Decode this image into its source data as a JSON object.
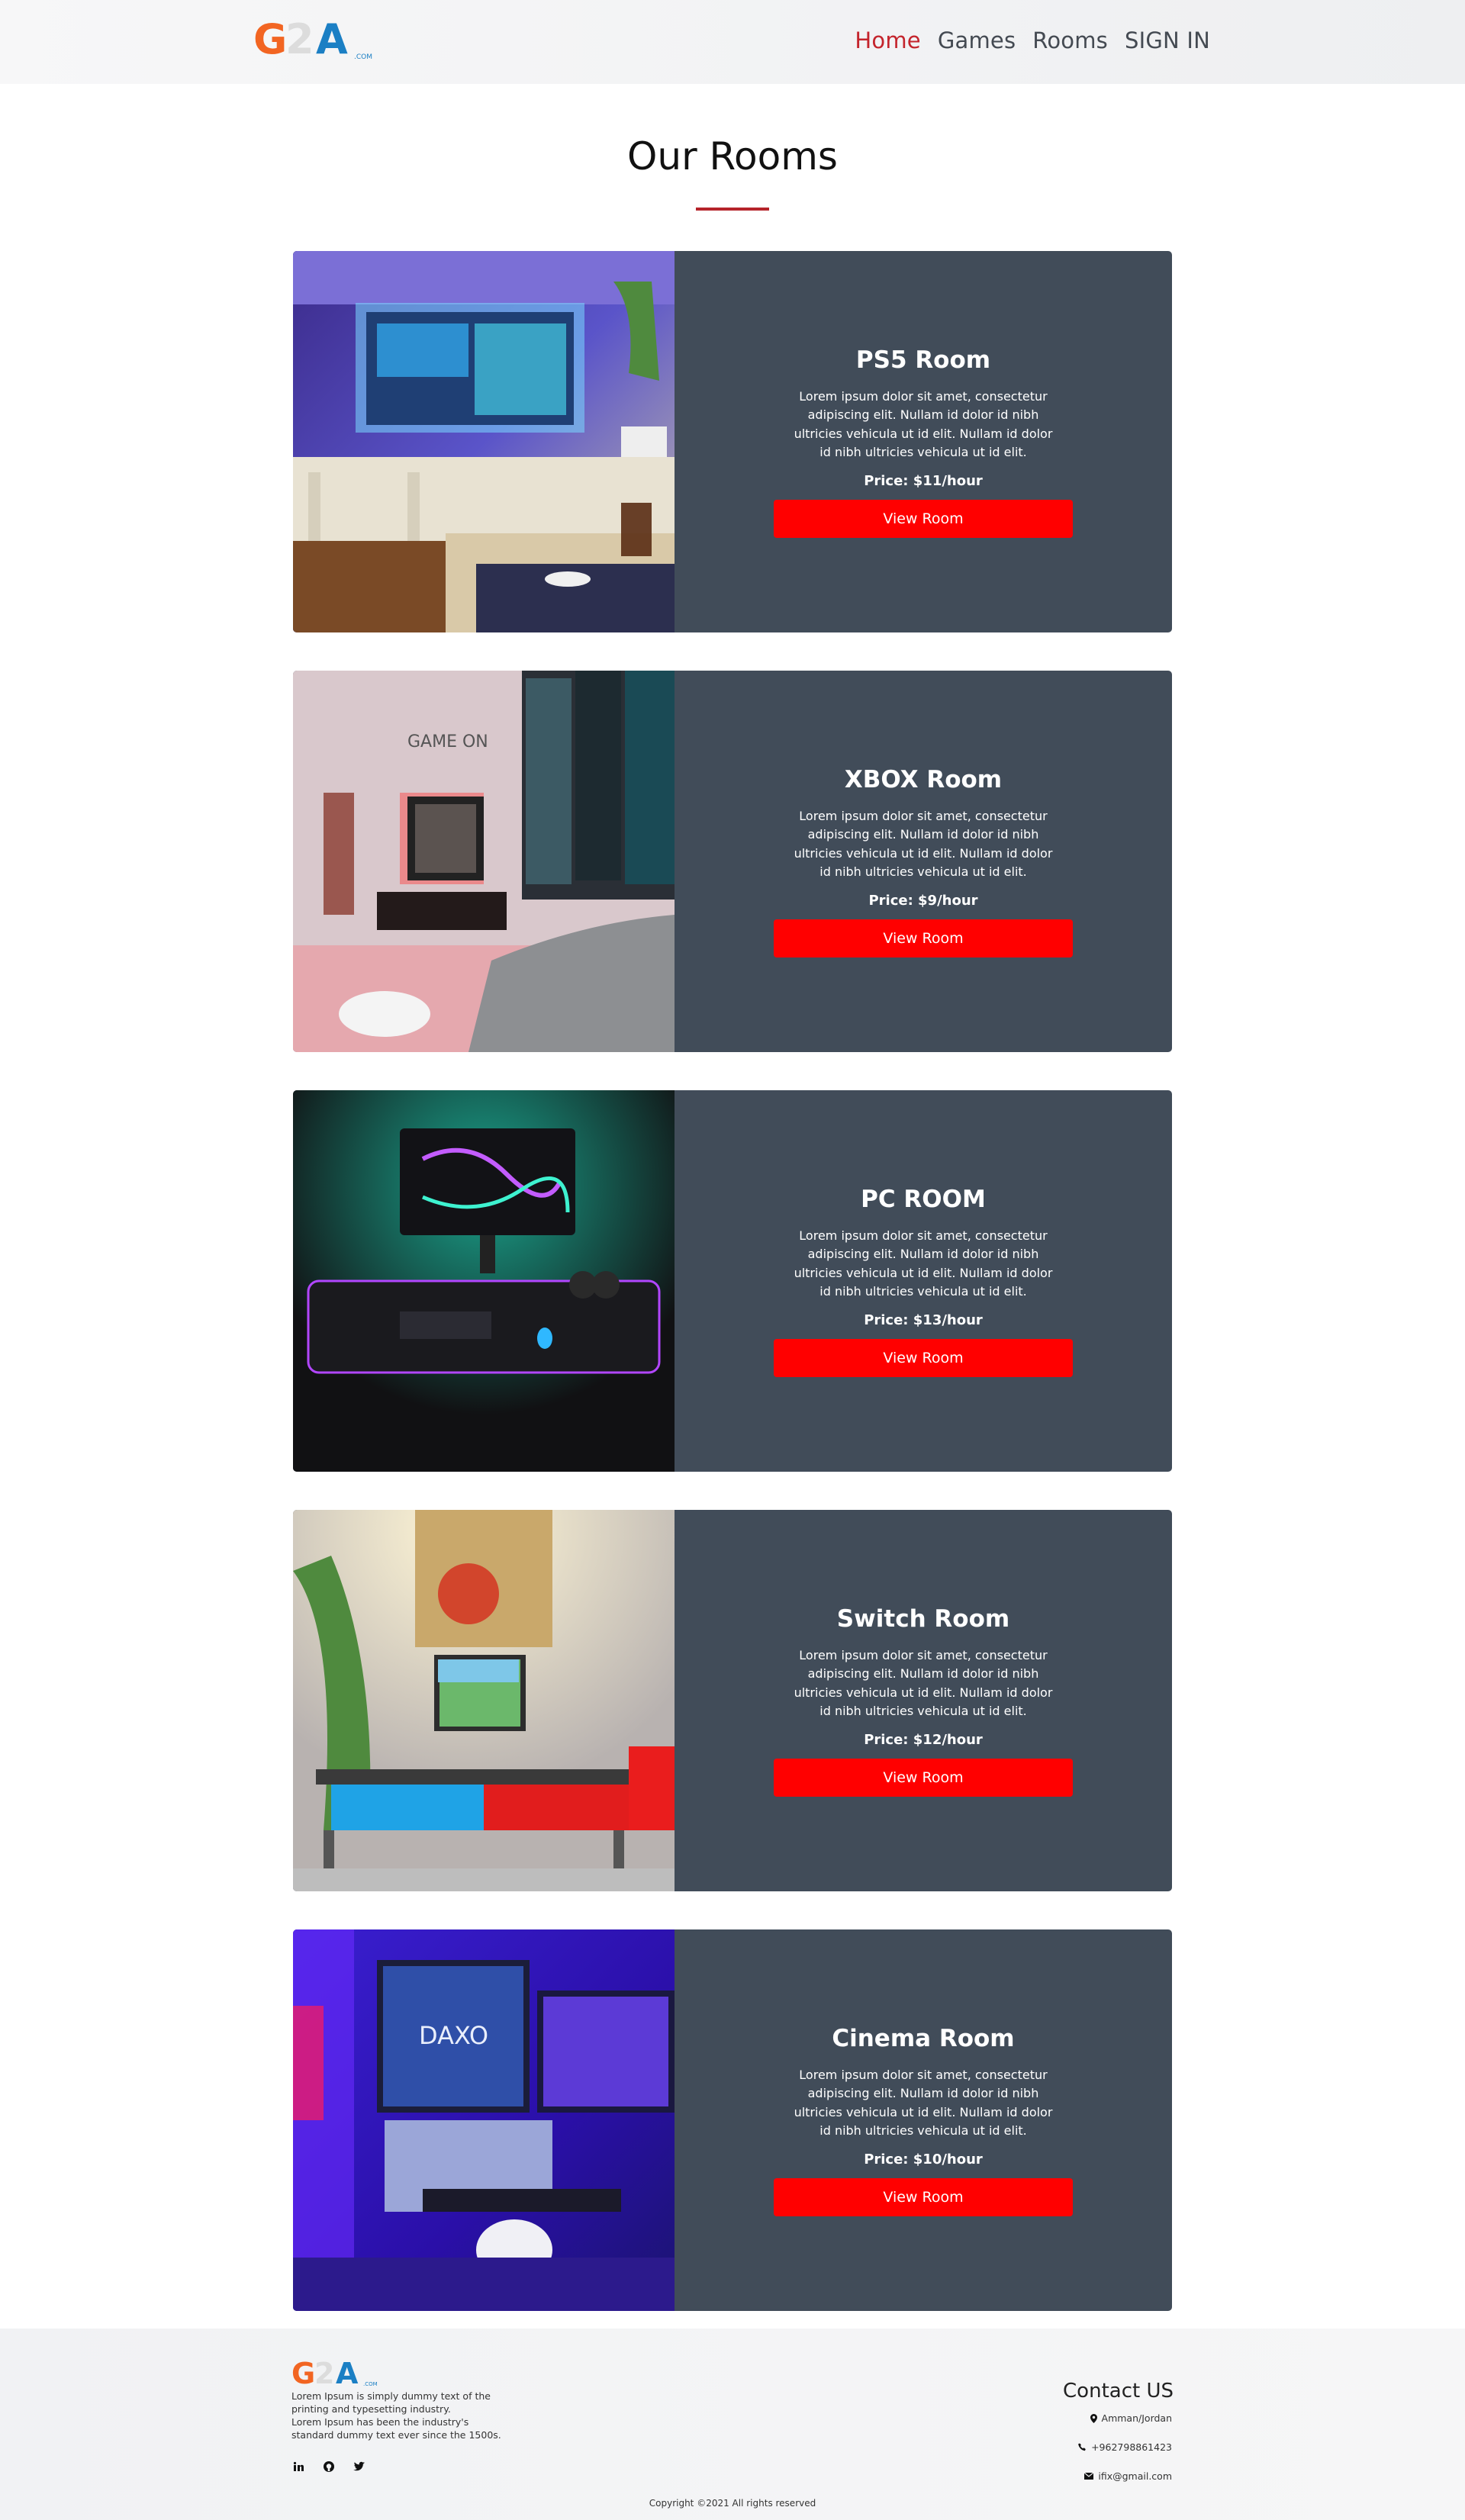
{
  "header": {
    "logo_text": "G2A",
    "logo_sub": ".COM",
    "nav": [
      {
        "label": "Home",
        "active": true
      },
      {
        "label": "Games",
        "active": false
      },
      {
        "label": "Rooms",
        "active": false
      },
      {
        "label": "SIGN IN",
        "active": false
      }
    ]
  },
  "main": {
    "title": "Our Rooms",
    "rooms": [
      {
        "name": "PS5 Room",
        "description": "Lorem ipsum dolor sit amet, consectetur adipiscing elit. Nullam id dolor id nibh ultricies vehicula ut id elit. Nullam id dolor id nibh ultricies vehicula ut id elit.",
        "price": "Price: $11/hour",
        "button": "View Room"
      },
      {
        "name": "XBOX Room",
        "description": "Lorem ipsum dolor sit amet, consectetur adipiscing elit. Nullam id dolor id nibh ultricies vehicula ut id elit. Nullam id dolor id nibh ultricies vehicula ut id elit.",
        "price": "Price: $9/hour",
        "button": "View Room"
      },
      {
        "name": "PC ROOM",
        "description": "Lorem ipsum dolor sit amet, consectetur adipiscing elit. Nullam id dolor id nibh ultricies vehicula ut id elit. Nullam id dolor id nibh ultricies vehicula ut id elit.",
        "price": "Price: $13/hour",
        "button": "View Room"
      },
      {
        "name": "Switch Room",
        "description": "Lorem ipsum dolor sit amet, consectetur adipiscing elit. Nullam id dolor id nibh ultricies vehicula ut id elit. Nullam id dolor id nibh ultricies vehicula ut id elit.",
        "price": "Price: $12/hour",
        "button": "View Room"
      },
      {
        "name": "Cinema Room",
        "description": "Lorem ipsum dolor sit amet, consectetur adipiscing elit. Nullam id dolor id nibh ultricies vehicula ut id elit. Nullam id dolor id nibh ultricies vehicula ut id elit.",
        "price": "Price: $10/hour",
        "button": "View Room"
      }
    ]
  },
  "footer": {
    "about_lines": [
      "Lorem Ipsum is simply dummy text of the",
      "printing and typesetting industry.",
      "Lorem Ipsum has been the industry's",
      "standard dummy text ever since the 1500s."
    ],
    "social_icons": [
      "linkedin-icon",
      "github-icon",
      "twitter-icon"
    ],
    "contact_title": "Contact US",
    "location": "Amman/Jordan",
    "phone": "+962798861423",
    "email": "ifix@gmail.com",
    "copyright": "Copyright ©2021 All rights reserved"
  },
  "colors": {
    "accent_red": "#ff0000",
    "nav_active": "#c4242c",
    "card_bg": "#414c59",
    "logo_orange": "#f26522",
    "logo_blue": "#1b7fc4"
  }
}
